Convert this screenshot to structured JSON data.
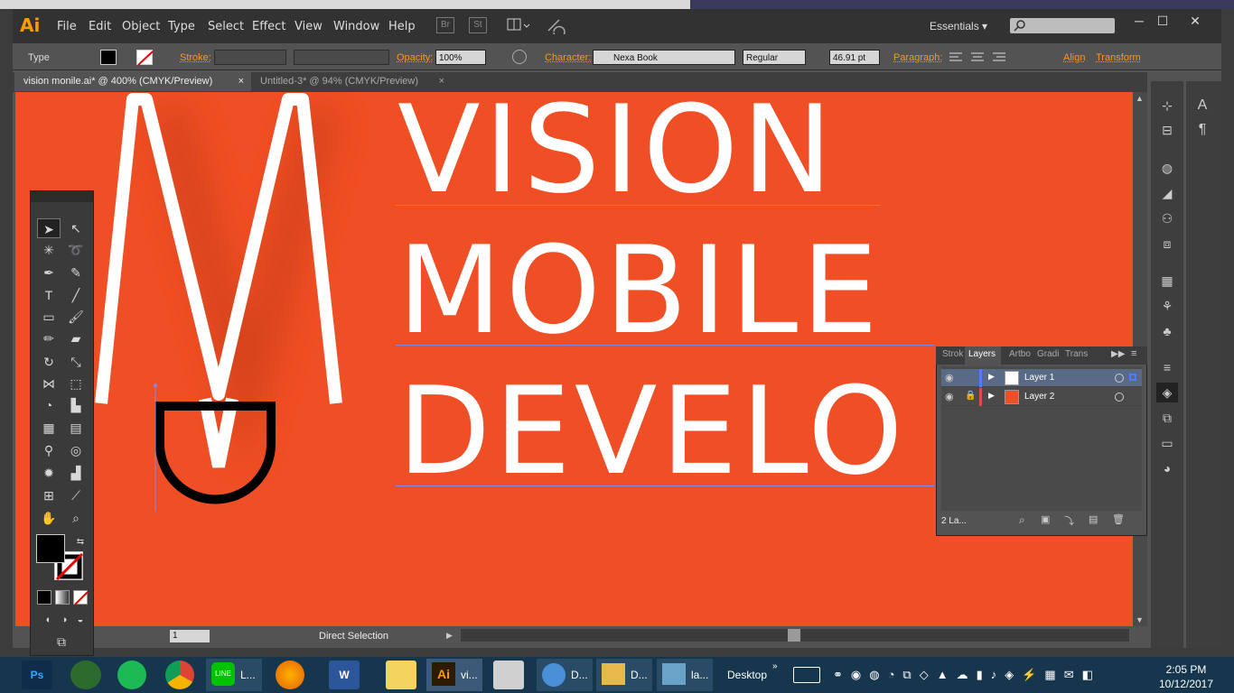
{
  "app": {
    "logo": "Ai",
    "menus": [
      "File",
      "Edit",
      "Object",
      "Type",
      "Select",
      "Effect",
      "View",
      "Window",
      "Help"
    ],
    "br_btn": "Br",
    "st_btn": "St",
    "workspace": "Essentials",
    "workspace_arrow": "▾"
  },
  "control_bar": {
    "type_label": "Type",
    "stroke_label": "Stroke:",
    "opacity_label": "Opacity:",
    "opacity_value": "100%",
    "character_label": "Character:",
    "font_name": "Nexa Book",
    "font_style": "Regular",
    "font_size": "46.91 pt",
    "paragraph_label": "Paragraph:",
    "align_label": "Align",
    "transform_label": "Transform"
  },
  "tabs": [
    {
      "label": "vision monile.ai* @ 400% (CMYK/Preview)",
      "close": "×"
    },
    {
      "label": "Untitled-3* @ 94% (CMYK/Preview)",
      "close": "×"
    }
  ],
  "artwork": {
    "line1": "VISION",
    "line2": "MOBILE",
    "line3": "DEVELO",
    "brand_color": "#f04e24"
  },
  "status": {
    "page": "1",
    "tool": "Direct Selection"
  },
  "layers_panel": {
    "tabs": [
      "Strok",
      "Layers",
      "Artbo",
      "Gradi",
      "Trans"
    ],
    "rows": [
      {
        "name": "Layer 1",
        "color": "#4f7bff"
      },
      {
        "name": "Layer 2",
        "color": "#e24a4a"
      }
    ],
    "footer": "2 La..."
  },
  "taskbar": {
    "items": [
      {
        "label": "Ps",
        "color": "#0f2c4a"
      },
      {
        "label": "",
        "color": "#2d6a2d"
      },
      {
        "label": "",
        "color": "#1db954"
      },
      {
        "label": "",
        "color": "#e8e8e8"
      },
      {
        "label": "L...",
        "color": "#00c300"
      },
      {
        "label": "",
        "color": "#e66000"
      },
      {
        "label": "W",
        "color": "#2b579a"
      },
      {
        "label": "",
        "color": "#f4d35e"
      },
      {
        "label": "vi...",
        "color": "#2d1b00"
      },
      {
        "label": "",
        "color": "#d0d0d0"
      },
      {
        "label": "D...",
        "color": "#4a90d9"
      },
      {
        "label": "D...",
        "color": "#e8b84a"
      },
      {
        "label": "la...",
        "color": "#6aa3c8"
      }
    ],
    "desktop": "Desktop",
    "time": "2:05 PM",
    "date": "10/12/2017"
  }
}
